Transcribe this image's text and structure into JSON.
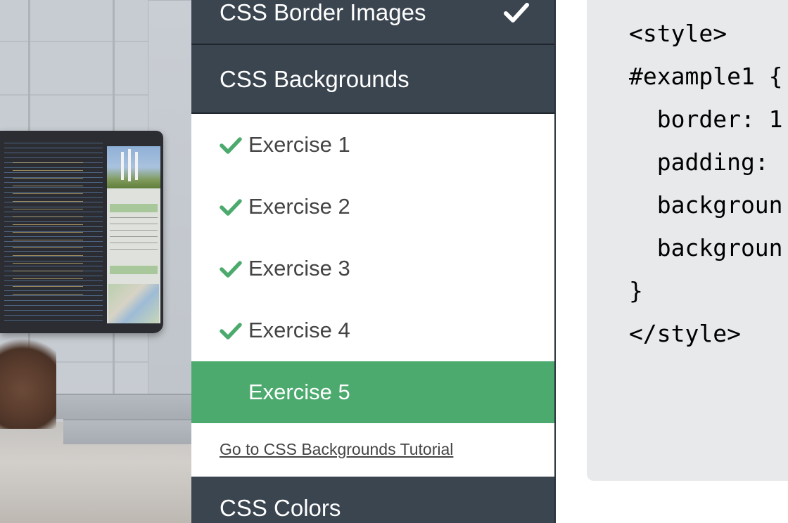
{
  "sidebar": {
    "sections": {
      "border_images": "CSS Border Images",
      "backgrounds": "CSS Backgrounds",
      "colors": "CSS Colors"
    },
    "exercises": [
      {
        "label": "Exercise 1",
        "completed": true
      },
      {
        "label": "Exercise 2",
        "completed": true
      },
      {
        "label": "Exercise 3",
        "completed": true
      },
      {
        "label": "Exercise 4",
        "completed": true
      },
      {
        "label": "Exercise 5",
        "completed": false,
        "active": true
      }
    ],
    "tutorial_link": "Go to CSS Backgrounds Tutorial",
    "icons": {
      "section_complete": "checkmark-icon",
      "exercise_complete": "checkmark-icon"
    }
  },
  "code": {
    "lines": [
      "<style>",
      "#example1 {",
      "  border: 1",
      "  padding:",
      "  backgroun",
      "  backgroun",
      "}",
      "</style>"
    ]
  },
  "colors": {
    "sidebar_bg": "#3a4550",
    "active_green": "#4caa6e",
    "check_green": "#4caa6e",
    "code_bg": "#e7e9eb"
  }
}
